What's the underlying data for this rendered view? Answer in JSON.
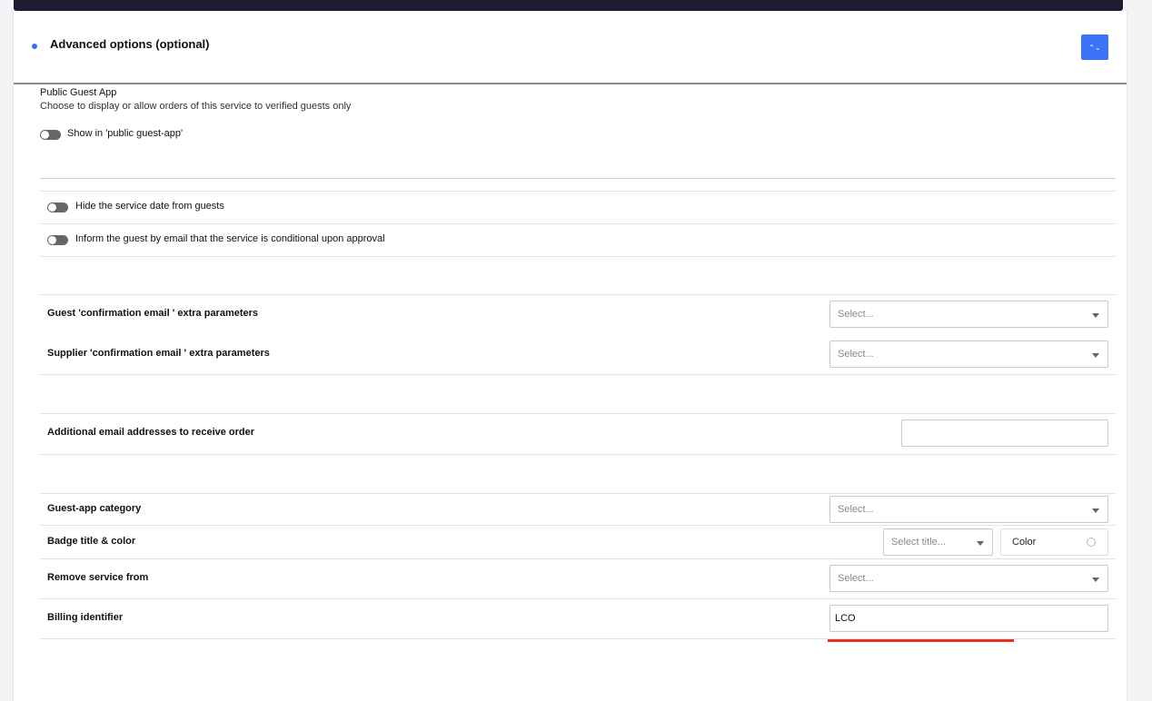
{
  "section": {
    "title": "Advanced options (optional)",
    "collapse_glyph": "⌃⌄"
  },
  "public_guest_app": {
    "heading": "Public Guest App",
    "description": "Choose to display or allow orders of this service to verified guests only",
    "toggle_label": "Show in 'public guest-app'"
  },
  "toggles": {
    "hide_date": "Hide the service date from guests",
    "inform_guest": "Inform the guest by email that the service is conditional upon approval"
  },
  "rows": {
    "guest_confirmation": {
      "label": "Guest 'confirmation email ' extra parameters",
      "placeholder": "Select..."
    },
    "supplier_confirmation": {
      "label": "Supplier 'confirmation email ' extra parameters",
      "placeholder": "Select..."
    },
    "additional_emails": {
      "label": "Additional email addresses to receive order",
      "value": ""
    },
    "guest_app_category": {
      "label": "Guest-app category",
      "placeholder": "Select..."
    },
    "badge": {
      "label": "Badge title & color",
      "title_placeholder": "Select title...",
      "color_label": "Color"
    },
    "remove_service": {
      "label": "Remove service from",
      "placeholder": "Select..."
    },
    "billing_identifier": {
      "label": "Billing identifier",
      "value": "LCO"
    }
  },
  "colors": {
    "accent": "#3d73f5",
    "topbar": "#1f1a2e",
    "highlight": "#e53424"
  }
}
